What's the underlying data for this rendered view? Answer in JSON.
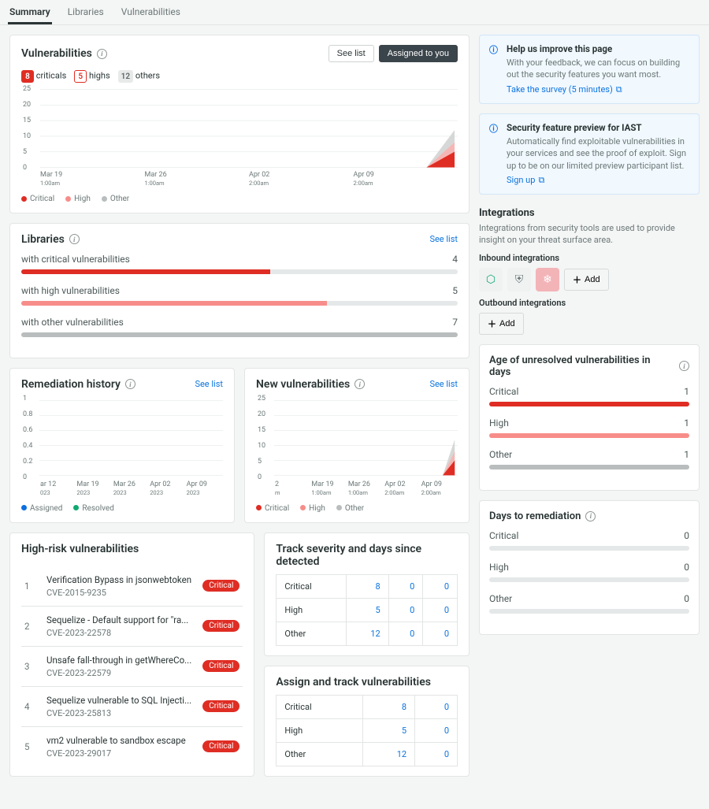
{
  "tabs": [
    "Summary",
    "Libraries",
    "Vulnerabilities"
  ],
  "vuln_card": {
    "title": "Vulnerabilities",
    "see_list": "See list",
    "assigned": "Assigned to you",
    "counts": {
      "criticals": 8,
      "criticals_label": "criticals",
      "highs": 5,
      "highs_label": "highs",
      "others": 12,
      "others_label": "others"
    },
    "legend": [
      "Critical",
      "High",
      "Other"
    ],
    "chart_data": {
      "type": "area",
      "ylim": [
        0,
        25
      ],
      "yticks": [
        0,
        5,
        10,
        15,
        20,
        25
      ],
      "xticks": [
        "Mar 19, 1:00am",
        "Mar 26, 1:00am",
        "Apr 02, 2:00am",
        "Apr 09, 2:00am"
      ],
      "series": [
        {
          "name": "Critical",
          "values_estimate": "0 throughout then rises to ~8 by rightmost"
        },
        {
          "name": "High",
          "values_estimate": "0 throughout then rises to ~5"
        },
        {
          "name": "Other",
          "values_estimate": "0 throughout then rises to ~12"
        }
      ]
    }
  },
  "libraries_card": {
    "title": "Libraries",
    "see_list": "See list",
    "rows": [
      {
        "label": "with critical vulnerabilities",
        "value": 4,
        "fill_pct": 57,
        "color": "#df2d24"
      },
      {
        "label": "with high vulnerabilities",
        "value": 5,
        "fill_pct": 70,
        "color": "#f78d8a"
      },
      {
        "label": "with other vulnerabilities",
        "value": 7,
        "fill_pct": 100,
        "color": "#b9bdbd"
      }
    ]
  },
  "remediation_card": {
    "title": "Remediation history",
    "see_list": "See list",
    "chart_data": {
      "type": "line",
      "ylim": [
        0,
        1
      ],
      "yticks": [
        0,
        0.2,
        0.4,
        0.6,
        0.8,
        1
      ],
      "xticks": [
        "ar 12, 023",
        "Mar 19, 2023",
        "Mar 26, 2023",
        "Apr 02, 2023",
        "Apr 09, 2023"
      ],
      "series": [
        {
          "name": "Assigned",
          "values_estimate": "flat at 0"
        },
        {
          "name": "Resolved",
          "values_estimate": "flat at 0"
        }
      ]
    },
    "legend": [
      "Assigned",
      "Resolved"
    ]
  },
  "newvulns_card": {
    "title": "New vulnerabilities",
    "see_list": "See list",
    "chart_data": {
      "type": "area",
      "ylim": [
        0,
        25
      ],
      "yticks": [
        0,
        5,
        10,
        15,
        20,
        25
      ],
      "xticks": [
        "2, m",
        "Mar 19, 1:00am",
        "Mar 26, 1:00am",
        "Apr 02, 2:00am",
        "Apr 09, 2:00am"
      ],
      "series": [
        {
          "name": "Critical",
          "values_estimate": "0 then spike to ~8 at right"
        },
        {
          "name": "High",
          "values_estimate": "0 then spike to ~5"
        },
        {
          "name": "Other",
          "values_estimate": "0 then spike to ~12"
        }
      ]
    },
    "legend": [
      "Critical",
      "High",
      "Other"
    ]
  },
  "highrisk_card": {
    "title": "High-risk vulnerabilities",
    "items": [
      {
        "idx": 1,
        "title": "Verification Bypass in jsonwebtoken",
        "cve": "CVE-2015-9235",
        "sev": "Critical"
      },
      {
        "idx": 2,
        "title": "Sequelize - Default support for \"ra...",
        "cve": "CVE-2023-22578",
        "sev": "Critical"
      },
      {
        "idx": 3,
        "title": "Unsafe fall-through in getWhereCo...",
        "cve": "CVE-2023-22579",
        "sev": "Critical"
      },
      {
        "idx": 4,
        "title": "Sequelize vulnerable to SQL Injecti...",
        "cve": "CVE-2023-25813",
        "sev": "Critical"
      },
      {
        "idx": 5,
        "title": "vm2 vulnerable to sandbox escape",
        "cve": "CVE-2023-29017",
        "sev": "Critical"
      }
    ]
  },
  "track_card": {
    "title": "Track severity and days since detected",
    "rows": [
      {
        "label": "Critical",
        "a": 8,
        "b": 0,
        "c": 0
      },
      {
        "label": "High",
        "a": 5,
        "b": 0,
        "c": 0
      },
      {
        "label": "Other",
        "a": 12,
        "b": 0,
        "c": 0
      }
    ]
  },
  "assign_card": {
    "title": "Assign and track vulnerabilities",
    "rows": [
      {
        "label": "Critical",
        "a": 8,
        "b": 0
      },
      {
        "label": "High",
        "a": 5,
        "b": 0
      },
      {
        "label": "Other",
        "a": 12,
        "b": 0
      }
    ]
  },
  "notice1": {
    "title": "Help us improve this page",
    "body": "With your feedback, we can focus on building out the security features you want most.",
    "link": "Take the survey (5 minutes)"
  },
  "notice2": {
    "title": "Security feature preview for IAST",
    "body": "Automatically find exploitable vulnerabilities in your services and see the proof of exploit. Sign up to be on our limited preview participant list.",
    "link": "Sign up"
  },
  "integrations_section": {
    "title": "Integrations",
    "desc": "Integrations from security tools are used to provide insight on your threat surface area.",
    "inbound_label": "Inbound integrations",
    "outbound_label": "Outbound integrations",
    "add": "Add",
    "inbound_icons": [
      "hexagon-icon",
      "shield-icon",
      "snowflake-icon"
    ]
  },
  "age_card": {
    "title": "Age of unresolved vulnerabilities in days",
    "rows": [
      {
        "label": "Critical",
        "value": 1,
        "cls": "c"
      },
      {
        "label": "High",
        "value": 1,
        "cls": "h"
      },
      {
        "label": "Other",
        "value": 1,
        "cls": "o"
      }
    ]
  },
  "days_card": {
    "title": "Days to remediation",
    "rows": [
      {
        "label": "Critical",
        "value": 0,
        "cls": "e"
      },
      {
        "label": "High",
        "value": 0,
        "cls": "e"
      },
      {
        "label": "Other",
        "value": 0,
        "cls": "e"
      }
    ]
  }
}
